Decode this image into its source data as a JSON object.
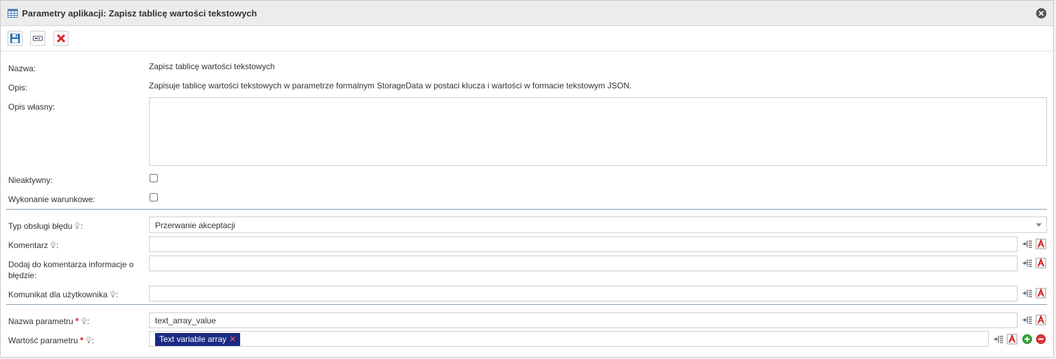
{
  "window": {
    "title": "Parametry aplikacji: Zapisz tablicę wartości tekstowych"
  },
  "toolbar": {
    "save_icon": "save-floppy-icon",
    "rename_icon": "rename-field-icon",
    "delete_icon": "delete-x-icon"
  },
  "form": {
    "name_label": "Nazwa:",
    "name_value": "Zapisz tablicę wartości tekstowych",
    "desc_label": "Opis:",
    "desc_value": "Zapisuje tablicę wartości tekstowych w parametrze formalnym StorageData w postaci klucza i wartości w formacie tekstowym JSON.",
    "own_desc_label": "Opis własny:",
    "own_desc_value": "",
    "inactive_label": "Nieaktywny:",
    "conditional_label": "Wykonanie warunkowe:",
    "error_type_label": "Typ obsługi błędu",
    "error_type_value": "Przerwanie akceptacji",
    "comment_label": "Komentarz",
    "add_to_comment_label": "Dodaj do komentarza informacje o błędzie:",
    "user_message_label": "Komunikat dla użytkownika",
    "param_name_label": "Nazwa parametru",
    "param_name_value": "text_array_value",
    "param_value_label": "Wartość parametru",
    "param_value_chip": "Text variable array",
    "colon": ":"
  },
  "colors": {
    "chip_bg": "#1b2b82",
    "required": "#d9232e",
    "separator": "#8ba0b8"
  }
}
